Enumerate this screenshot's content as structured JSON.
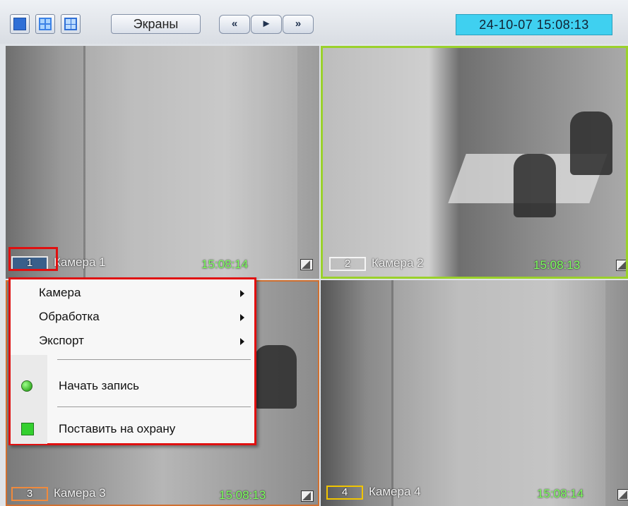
{
  "toolbar": {
    "screens_label": "Экраны",
    "nav_prev": "«",
    "nav_play": "►",
    "nav_next": "»",
    "datetime": "24-10-07   15:08:13"
  },
  "cameras": [
    {
      "number": "1",
      "name": "Камера 1",
      "time": "15:08:14"
    },
    {
      "number": "2",
      "name": "Камера 2",
      "time": "15:08:13"
    },
    {
      "number": "3",
      "name": "Камера 3",
      "time": "15:08:13"
    },
    {
      "number": "4",
      "name": "Камера 4",
      "time": "15:08:14"
    }
  ],
  "context_menu": {
    "items": [
      {
        "label": "Камера"
      },
      {
        "label": "Обработка"
      },
      {
        "label": "Экспорт"
      },
      {
        "label": "Начать запись"
      },
      {
        "label": "Поставить на охрану"
      }
    ]
  },
  "colors": {
    "cam2_frame": "#9ad12b",
    "cam3_frame": "#d07030",
    "highlight": "#e01010",
    "timestamp": "#7dff5e",
    "clock_bg": "#3fd0f0"
  }
}
